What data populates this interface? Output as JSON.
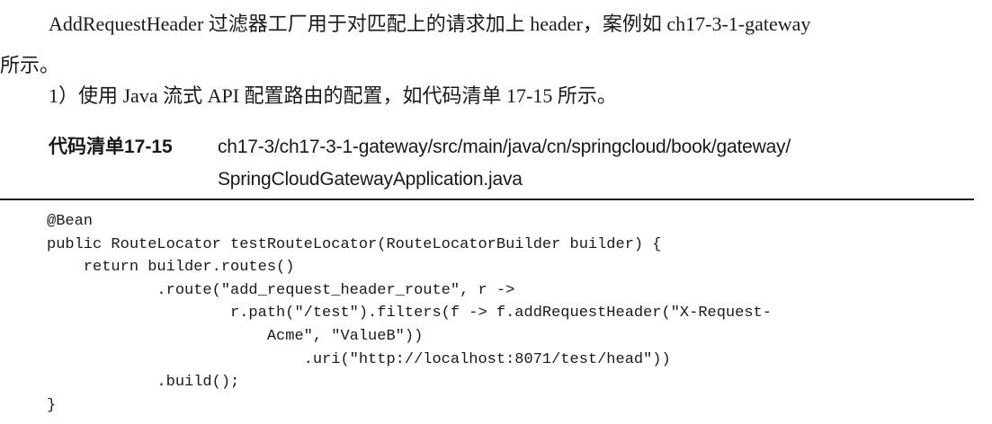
{
  "paragraphs": {
    "p1_line1": "AddRequestHeader 过滤器工厂用于对匹配上的请求加上 header，案例如 ch17-3-1-gateway",
    "p1_line2": "所示。",
    "p2": "1）使用 Java 流式 API 配置路由的配置，如代码清单 17-15 所示。"
  },
  "listing": {
    "label": "代码清单17-15",
    "path_line1": "ch17-3/ch17-3-1-gateway/src/main/java/cn/springcloud/book/gateway/",
    "path_line2": "SpringCloudGatewayApplication.java"
  },
  "code_lines": [
    "@Bean",
    "public RouteLocator testRouteLocator(RouteLocatorBuilder builder) {",
    "    return builder.routes()",
    "            .route(\"add_request_header_route\", r ->",
    "                    r.path(\"/test\").filters(f -> f.addRequestHeader(\"X-Request-",
    "                        Acme\", \"ValueB\"))",
    "                            .uri(\"http://localhost:8071/test/head\"))",
    "            .build();",
    "}"
  ]
}
